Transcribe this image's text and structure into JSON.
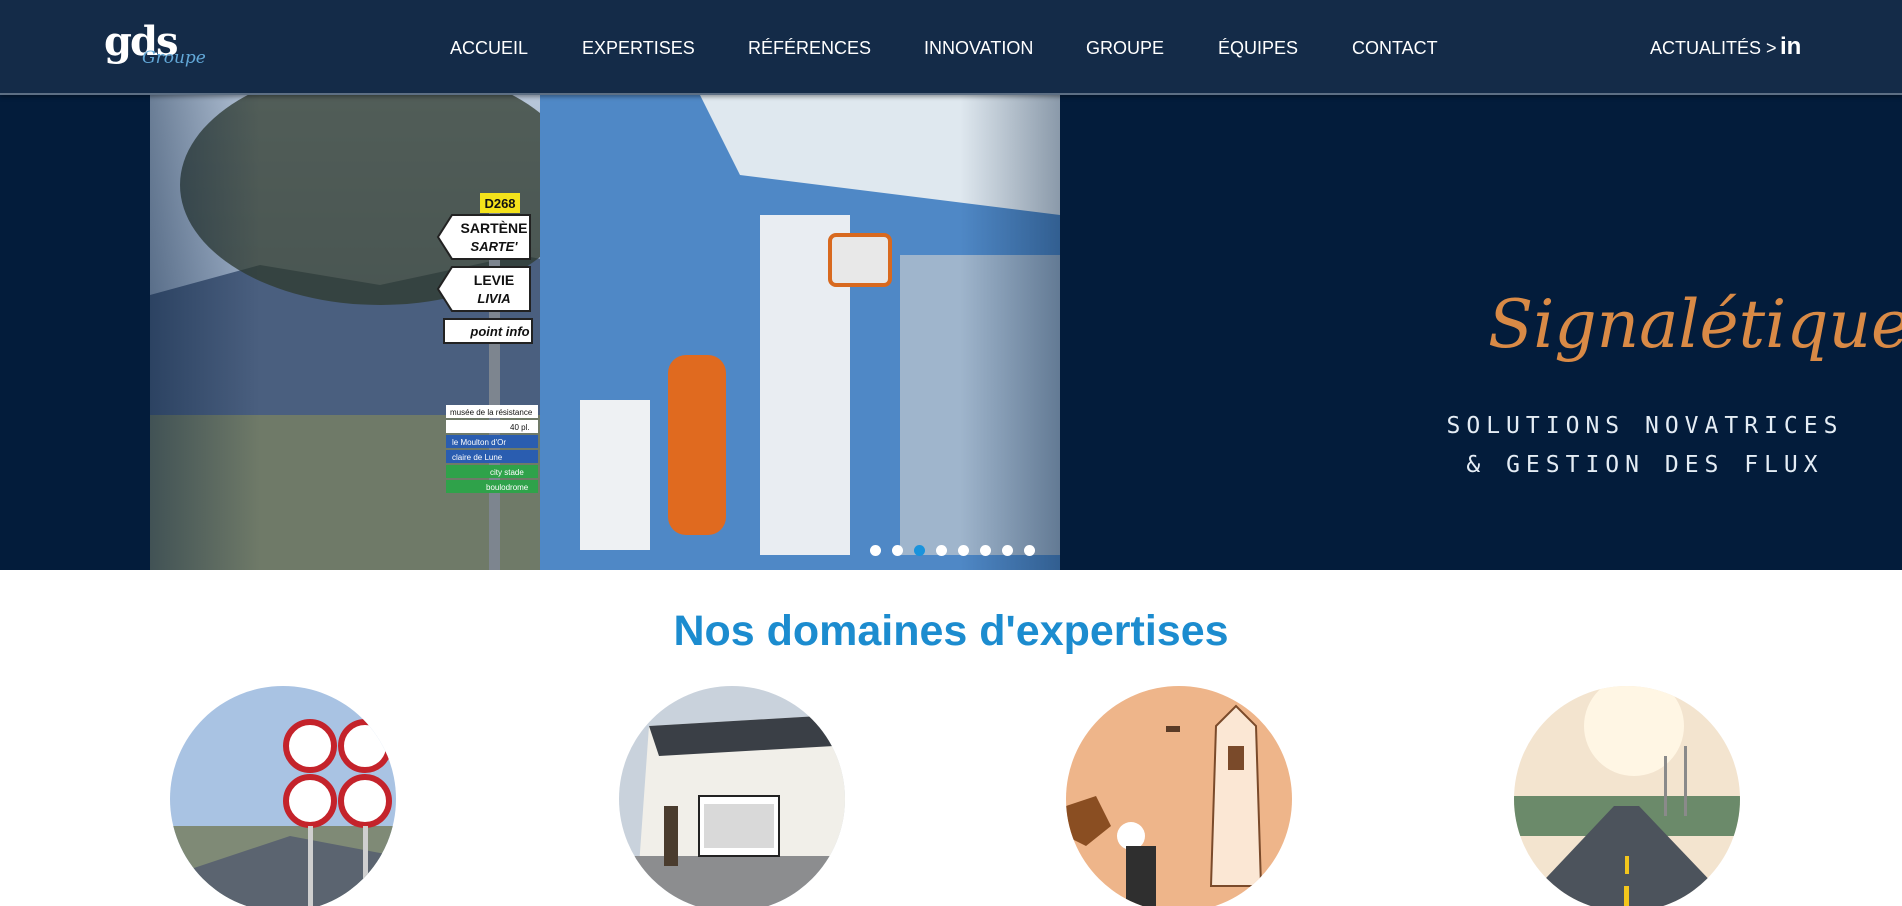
{
  "header": {
    "logo": {
      "main": "gds",
      "sub": "Groupe"
    },
    "nav": [
      "ACCUEIL",
      "EXPERTISES",
      "RÉFÉRENCES",
      "INNOVATION",
      "GROUPE",
      "ÉQUIPES",
      "CONTACT"
    ],
    "news_label": "ACTUALITÉS >",
    "linkedin_icon": "in"
  },
  "hero": {
    "title": "Signalétique",
    "subtitle_line1": "SOLUTIONS NOVATRICES",
    "subtitle_line2": "& GESTION DES FLUX",
    "signs": {
      "route": "D268",
      "dir1_line1": "SARTÈNE",
      "dir1_line2": "SARTE'",
      "dir2_line1": "LEVIE",
      "dir2_line2": "LIVIA",
      "info": "point info",
      "small1": "musée de la résistance",
      "small2": "40 pl.",
      "small3": "le Moulton d'Or",
      "small4": "claire de Lune",
      "small5": "city stade",
      "small6": "boulodrome"
    },
    "slider": {
      "count": 8,
      "active_index": 2
    }
  },
  "section": {
    "title": "Nos domaines d'expertises"
  },
  "colors": {
    "header_bg": "#142b48",
    "hero_bg": "#031c3b",
    "accent_blue": "#1c8ccf",
    "accent_orange": "#d98a46"
  },
  "icons": [
    "linkedin-icon"
  ]
}
